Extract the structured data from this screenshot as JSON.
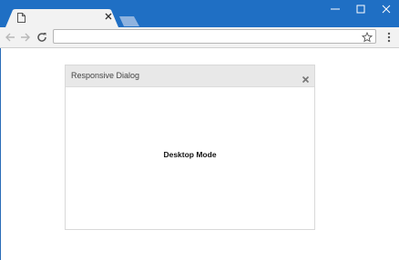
{
  "browser": {
    "tab": {
      "title": "",
      "page_icon": "page-icon",
      "close_icon": "close-icon"
    },
    "new_tab_icon": "new-tab-icon",
    "window_controls": [
      "minimize-icon",
      "maximize-icon",
      "close-icon"
    ],
    "toolbar": {
      "back_icon": "back-arrow-icon",
      "forward_icon": "forward-arrow-icon",
      "reload_icon": "reload-icon",
      "address_value": "",
      "bookmark_icon": "star-icon",
      "menu_icon": "kebab-menu-icon"
    },
    "colors": {
      "titlebar": "#1f6fc4",
      "toolbar": "#f2f2f2"
    }
  },
  "dialog": {
    "title": "Responsive Dialog",
    "close_icon": "close-icon",
    "message": "Desktop Mode",
    "colors": {
      "header": "#e8e8e8",
      "border": "#d9d9d9"
    }
  }
}
